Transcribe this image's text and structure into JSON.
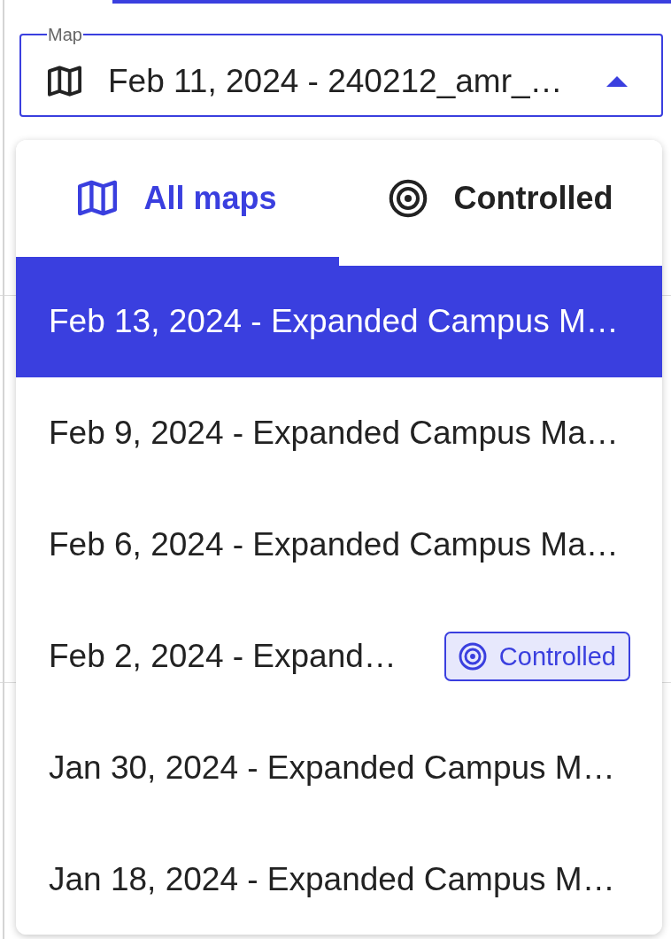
{
  "map_field": {
    "label": "Map",
    "value": "Feb 11, 2024 - 240212_amr_…",
    "expanded": true
  },
  "dropdown": {
    "tabs": [
      {
        "kind": "all",
        "label": "All maps",
        "selected": true
      },
      {
        "kind": "controlled",
        "label": "Controlled",
        "selected": false
      }
    ],
    "items": [
      {
        "label": "Feb 13, 2024 - Expanded Campus M…",
        "selected": true
      },
      {
        "label": "Feb 9, 2024 - Expanded Campus Ma…",
        "selected": false
      },
      {
        "label": "Feb 6, 2024 - Expanded Campus Ma…",
        "selected": false
      },
      {
        "label": "Feb 2, 2024 - Expand…",
        "selected": false,
        "badge": "Controlled"
      },
      {
        "label": "Jan 30, 2024 - Expanded Campus M…",
        "selected": false
      },
      {
        "label": "Jan 18, 2024 - Expanded Campus M…",
        "selected": false
      }
    ]
  }
}
